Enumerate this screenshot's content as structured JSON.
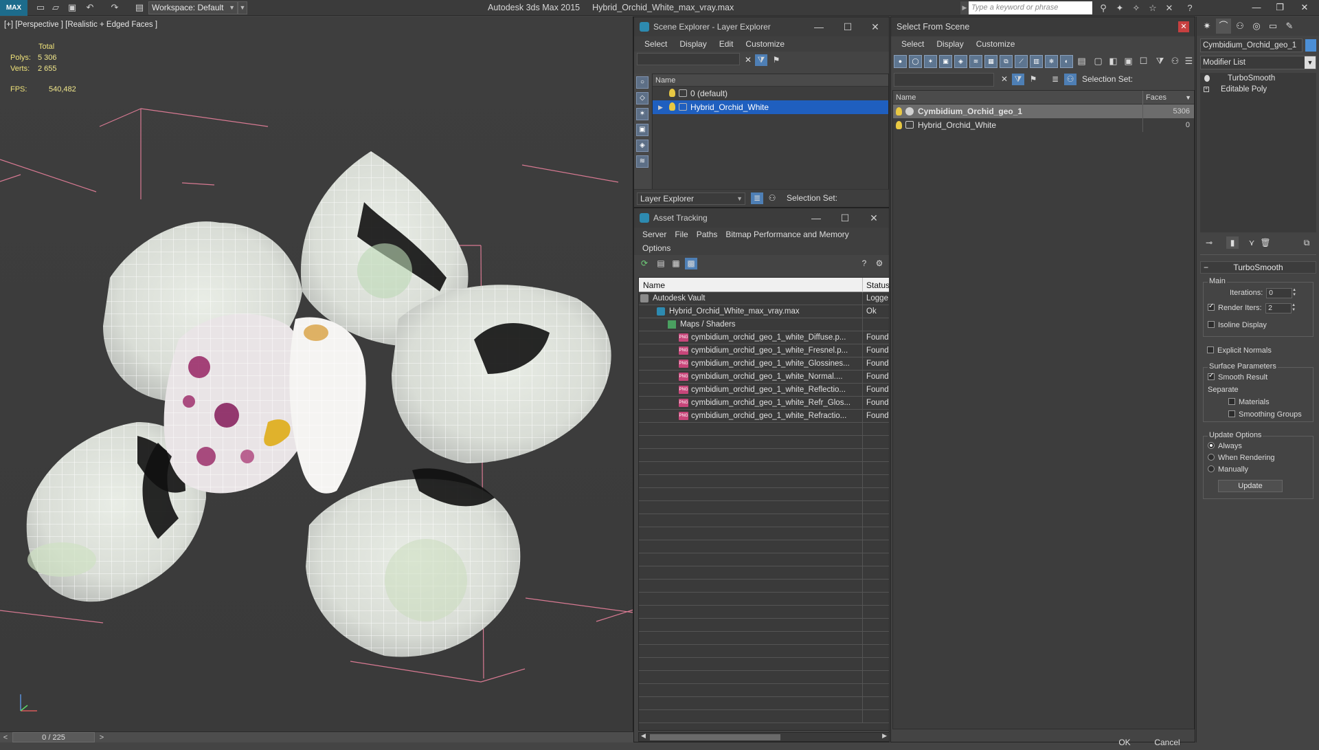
{
  "titlebar": {
    "logo": "MAX",
    "workspace": "Workspace: Default",
    "app_name": "Autodesk 3ds Max  2015",
    "file_name": "Hybrid_Orchid_White_max_vray.max",
    "search_placeholder": "Type a keyword or phrase"
  },
  "viewport": {
    "label": "[+] [Perspective ] [Realistic + Edged Faces ]",
    "stats_title": "Total",
    "polys_label": "Polys:",
    "polys_value": "5 306",
    "verts_label": "Verts:",
    "verts_value": "2 655",
    "fps_label": "FPS:",
    "fps_value": "540,482"
  },
  "timeline": {
    "frame": "0 / 225",
    "prev": "<",
    "next": ">"
  },
  "scene_explorer": {
    "title": "Scene Explorer - Layer Explorer",
    "menu": [
      "Select",
      "Display",
      "Edit",
      "Customize"
    ],
    "column_name": "Name",
    "rows": [
      {
        "label": "0 (default)",
        "selected": false
      },
      {
        "label": "Hybrid_Orchid_White",
        "selected": true
      }
    ],
    "explorer_dropdown": "Layer Explorer",
    "selection_set_label": "Selection Set:"
  },
  "asset_tracking": {
    "title": "Asset Tracking",
    "menu": [
      "Server",
      "File",
      "Paths",
      "Bitmap Performance and Memory"
    ],
    "menu2": [
      "Options"
    ],
    "col_name": "Name",
    "col_status": "Status",
    "rows": [
      {
        "name": "Autodesk Vault",
        "status": "Logge",
        "icon": "vault-icon",
        "indent": 20
      },
      {
        "name": "Hybrid_Orchid_White_max_vray.max",
        "status": "Ok",
        "icon": "max-file-icon",
        "indent": 44
      },
      {
        "name": "Maps / Shaders",
        "status": "",
        "icon": "folder-icon",
        "indent": 60
      },
      {
        "name": "cymbidium_orchid_geo_1_white_Diffuse.p...",
        "status": "Found",
        "icon": "png-icon",
        "indent": 76
      },
      {
        "name": "cymbidium_orchid_geo_1_white_Fresnel.p...",
        "status": "Found",
        "icon": "png-icon",
        "indent": 76
      },
      {
        "name": "cymbidium_orchid_geo_1_white_Glossines...",
        "status": "Found",
        "icon": "png-icon",
        "indent": 76
      },
      {
        "name": "cymbidium_orchid_geo_1_white_Normal....",
        "status": "Found",
        "icon": "png-icon",
        "indent": 76
      },
      {
        "name": "cymbidium_orchid_geo_1_white_Reflectio...",
        "status": "Found",
        "icon": "png-icon",
        "indent": 76
      },
      {
        "name": "cymbidium_orchid_geo_1_white_Refr_Glos...",
        "status": "Found",
        "icon": "png-icon",
        "indent": 76
      },
      {
        "name": "cymbidium_orchid_geo_1_white_Refractio...",
        "status": "Found",
        "icon": "png-icon",
        "indent": 76
      }
    ],
    "png_badge": "PNG"
  },
  "select_from_scene": {
    "title": "Select From Scene",
    "menu": [
      "Select",
      "Display",
      "Customize"
    ],
    "selection_set_label": "Selection Set:",
    "col_name": "Name",
    "col_faces": "Faces",
    "rows": [
      {
        "name": "Cymbidium_Orchid_geo_1",
        "faces": "5306",
        "selected": true,
        "type": "object"
      },
      {
        "name": "Hybrid_Orchid_White",
        "faces": "0",
        "selected": false,
        "type": "layer"
      }
    ],
    "ok": "OK",
    "cancel": "Cancel"
  },
  "command_panel": {
    "object_name": "Cymbidium_Orchid_geo_1",
    "object_color": "#4c8fd6",
    "modifier_list": "Modifier List",
    "stack": [
      "TurboSmooth",
      "Editable Poly"
    ],
    "turbosmooth": {
      "title": "TurboSmooth",
      "main_group": "Main",
      "iterations_label": "Iterations:",
      "iterations_value": "0",
      "render_iters_label": "Render Iters:",
      "render_iters_value": "2",
      "render_iters_checked": true,
      "isoline_label": "Isoline Display",
      "explicit_normals_label": "Explicit Normals",
      "surface_group": "Surface Parameters",
      "smooth_result_label": "Smooth Result",
      "separate_label": "Separate",
      "materials_label": "Materials",
      "smoothing_groups_label": "Smoothing Groups",
      "update_group": "Update Options",
      "always_label": "Always",
      "when_rendering_label": "When Rendering",
      "manually_label": "Manually",
      "update_button": "Update"
    }
  },
  "colors": {
    "selection_blue": "#1f5fbf",
    "stat_yellow": "#f0e37a",
    "bbox_pink": "#e0809a"
  }
}
